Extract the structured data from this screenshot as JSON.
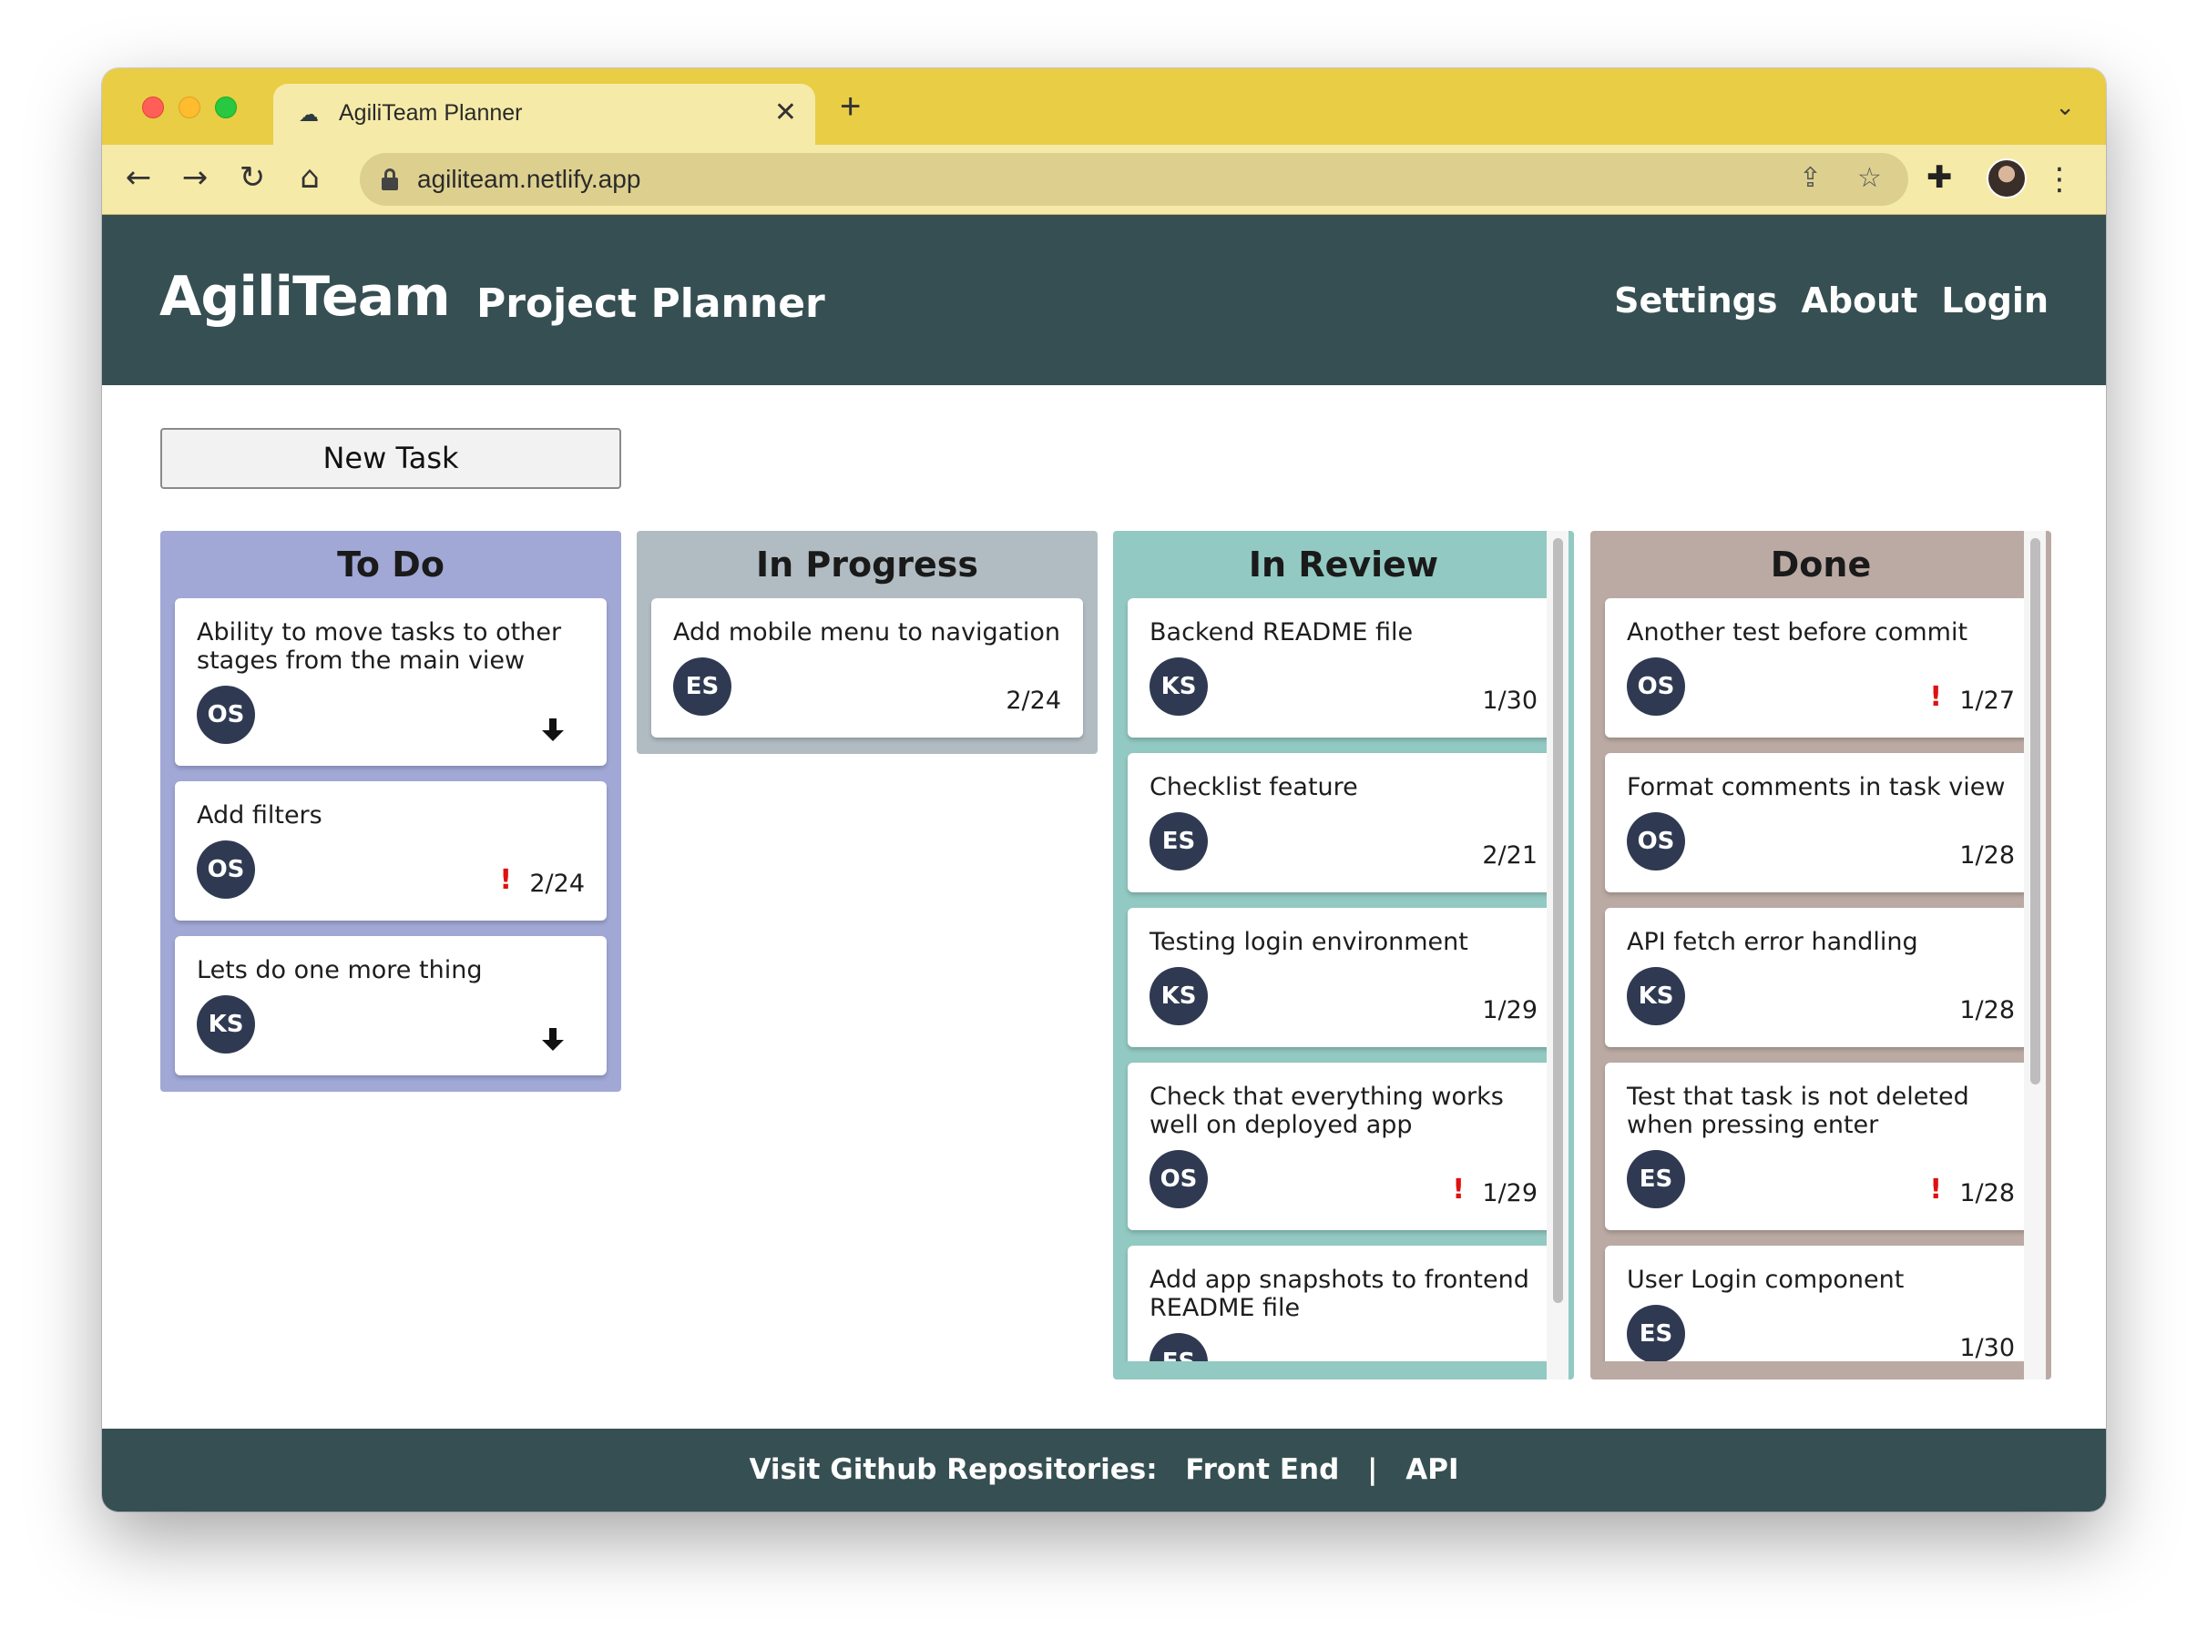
{
  "browser": {
    "tab_title": "AgiliTeam Planner",
    "tab_close": "✕",
    "new_tab": "+",
    "tab_menu": "⌄",
    "url": "agiliteam.netlify.app",
    "back": "←",
    "forward": "→",
    "reload": "↻",
    "home": "⌂",
    "share": "⇪",
    "bookmark": "☆",
    "extensions": "✚",
    "menu": "⋮"
  },
  "header": {
    "brand": "AgiliTeam",
    "subtitle": "Project Planner",
    "nav": [
      "Settings",
      "About",
      "Login"
    ]
  },
  "new_task_label": "New Task",
  "columns": [
    {
      "title": "To Do",
      "color": "#a1a8d6",
      "cards": [
        {
          "title": "Ability to move tasks to other stages from the main view",
          "assignee": "OS",
          "priority": "low",
          "due": ""
        },
        {
          "title": "Add filters",
          "assignee": "OS",
          "priority": "high",
          "due": "2/24"
        },
        {
          "title": "Lets do one more thing",
          "assignee": "KS",
          "priority": "low",
          "due": ""
        }
      ]
    },
    {
      "title": "In Progress",
      "color": "#b1bcc2",
      "cards": [
        {
          "title": "Add mobile menu to navigation",
          "assignee": "ES",
          "priority": "",
          "due": "2/24"
        }
      ]
    },
    {
      "title": "In Review",
      "color": "#92c9c2",
      "cards": [
        {
          "title": "Backend README file",
          "assignee": "KS",
          "priority": "",
          "due": "1/30"
        },
        {
          "title": "Checklist feature",
          "assignee": "ES",
          "priority": "",
          "due": "2/21"
        },
        {
          "title": "Testing login environment",
          "assignee": "KS",
          "priority": "",
          "due": "1/29"
        },
        {
          "title": "Check that everything works well on deployed app",
          "assignee": "OS",
          "priority": "high",
          "due": "1/29"
        },
        {
          "title": "Add app snapshots to frontend README file",
          "assignee": "ES",
          "priority": "",
          "due": ""
        }
      ]
    },
    {
      "title": "Done",
      "color": "#bbaaa3",
      "cards": [
        {
          "title": "Another test before commit",
          "assignee": "OS",
          "priority": "high",
          "due": "1/27"
        },
        {
          "title": "Format comments in task view",
          "assignee": "OS",
          "priority": "",
          "due": "1/28"
        },
        {
          "title": "API fetch error handling",
          "assignee": "KS",
          "priority": "",
          "due": "1/28"
        },
        {
          "title": "Test that task is not deleted when pressing enter",
          "assignee": "ES",
          "priority": "high",
          "due": "1/28"
        },
        {
          "title": "User Login component",
          "assignee": "ES",
          "priority": "",
          "due": "1/30"
        }
      ]
    }
  ],
  "priority_high_symbol": "!",
  "footer": {
    "label": "Visit Github Repositories:",
    "links": [
      "Front End",
      "API"
    ],
    "separator": "|"
  }
}
